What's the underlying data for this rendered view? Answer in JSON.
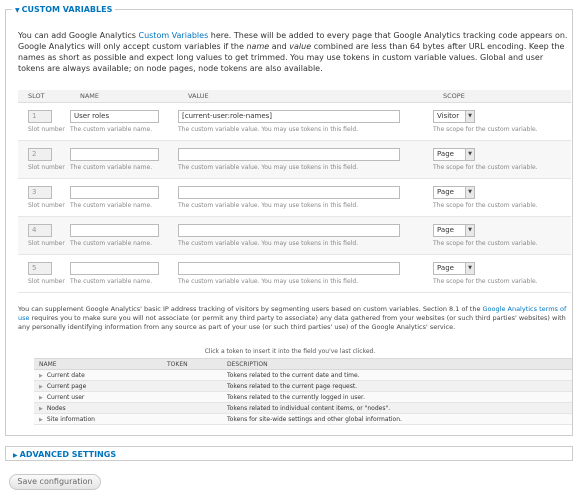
{
  "custom_variables": {
    "legend": "CUSTOM VARIABLES",
    "intro_1": "You can add Google Analytics ",
    "intro_link": "Custom Variables",
    "intro_2": " here. These will be added to every page that Google Analytics tracking code appears on. Google Analytics will only accept custom variables if the ",
    "intro_name": "name",
    "intro_3": " and ",
    "intro_value": "value",
    "intro_4": " combined are less than 64 bytes after URL encoding. Keep the names as short as possible and expect long values to get trimmed. You may use tokens in custom variable values. Global and user tokens are always available; on node pages, node tokens are also available.",
    "columns": [
      "SLOT",
      "NAME",
      "VALUE",
      "SCOPE"
    ],
    "slot_desc": "Slot number",
    "name_desc": "The custom variable name.",
    "value_desc": "The custom variable value. You may use tokens in this field.",
    "scope_desc": "The scope for the custom variable.",
    "rows": [
      {
        "slot": "1",
        "name": "User roles",
        "value": "[current-user:role-names]",
        "scope": "Visitor"
      },
      {
        "slot": "2",
        "name": "",
        "value": "",
        "scope": "Page"
      },
      {
        "slot": "3",
        "name": "",
        "value": "",
        "scope": "Page"
      },
      {
        "slot": "4",
        "name": "",
        "value": "",
        "scope": "Page"
      },
      {
        "slot": "5",
        "name": "",
        "value": "",
        "scope": "Page"
      }
    ],
    "supplement_1": "You can supplement Google Analytics' basic IP address tracking of visitors by segmenting users based on custom variables. Section 8.1 of the ",
    "supplement_link": "Google Analytics terms of use",
    "supplement_2": " requires you to make sure you will not associate (or permit any third party to associate) any data gathered from your websites (or such third parties' websites) with any personally identifying information from any source as part of your use (or such third parties' use) of the Google Analytics' service."
  },
  "tokens": {
    "hint": "Click a token to insert it into the field you've last clicked.",
    "columns": [
      "NAME",
      "TOKEN",
      "DESCRIPTION"
    ],
    "rows": [
      {
        "name": "Current date",
        "token": "",
        "description": "Tokens related to the current date and time."
      },
      {
        "name": "Current page",
        "token": "",
        "description": "Tokens related to the current page request."
      },
      {
        "name": "Current user",
        "token": "",
        "description": "Tokens related to the currently logged in user."
      },
      {
        "name": "Nodes",
        "token": "",
        "description": "Tokens related to individual content items, or \"nodes\"."
      },
      {
        "name": "Site information",
        "token": "",
        "description": "Tokens for site-wide settings and other global information."
      }
    ]
  },
  "advanced": {
    "legend": "ADVANCED SETTINGS"
  },
  "save_button": "Save configuration",
  "colors": {
    "link": "#0074bd",
    "border": "#cccccc"
  },
  "icons": {
    "expand": "triangle-down-icon",
    "collapsed": "triangle-right-icon",
    "select": "select-arrow-icon"
  }
}
